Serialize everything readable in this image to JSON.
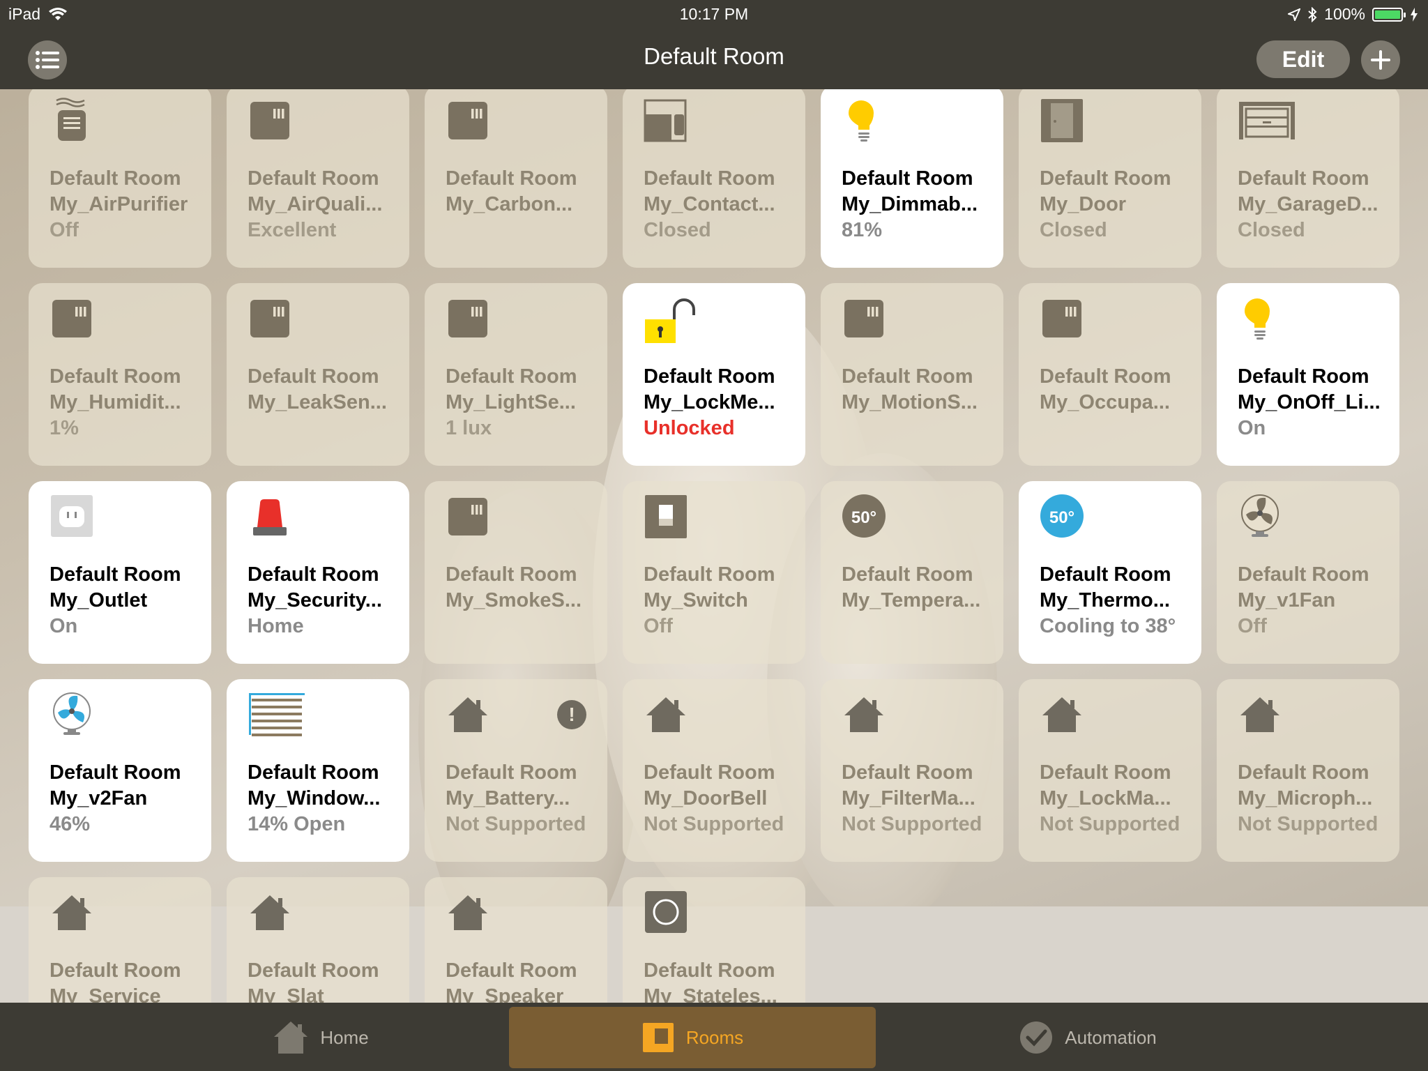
{
  "status_bar": {
    "device": "iPad",
    "time": "10:17 PM",
    "battery": "100%"
  },
  "nav": {
    "title": "Default Room",
    "edit_label": "Edit"
  },
  "tiles": [
    {
      "room": "Default Room",
      "name": "My_AirPurifier",
      "status": "Off",
      "state": "off",
      "icon": "air-purifier-icon"
    },
    {
      "room": "Default Room",
      "name": "My_AirQuali...",
      "status": "Excellent",
      "state": "off",
      "icon": "sensor-icon"
    },
    {
      "room": "Default Room",
      "name": "My_Carbon...",
      "status": "",
      "state": "off",
      "icon": "sensor-icon"
    },
    {
      "room": "Default Room",
      "name": "My_Contact...",
      "status": "Closed",
      "state": "off",
      "icon": "contact-sensor-icon"
    },
    {
      "room": "Default Room",
      "name": "My_Dimmab...",
      "status": "81%",
      "state": "on",
      "icon": "lightbulb-icon"
    },
    {
      "room": "Default Room",
      "name": "My_Door",
      "status": "Closed",
      "state": "off",
      "icon": "door-icon"
    },
    {
      "room": "Default Room",
      "name": "My_GarageD...",
      "status": "Closed",
      "state": "off",
      "icon": "garage-door-icon"
    },
    {
      "room": "Default Room",
      "name": "My_Humidit...",
      "status": "1%",
      "state": "off",
      "icon": "sensor-icon"
    },
    {
      "room": "Default Room",
      "name": "My_LeakSen...",
      "status": "",
      "state": "off",
      "icon": "sensor-icon"
    },
    {
      "room": "Default Room",
      "name": "My_LightSe...",
      "status": "1 lux",
      "state": "off",
      "icon": "sensor-icon"
    },
    {
      "room": "Default Room",
      "name": "My_LockMe...",
      "status": "Unlocked",
      "state": "on",
      "icon": "unlocked-padlock-icon",
      "status_color": "red"
    },
    {
      "room": "Default Room",
      "name": "My_MotionS...",
      "status": "",
      "state": "off",
      "icon": "sensor-icon"
    },
    {
      "room": "Default Room",
      "name": "My_Occupa...",
      "status": "",
      "state": "off",
      "icon": "sensor-icon"
    },
    {
      "room": "Default Room",
      "name": "My_OnOff_Li...",
      "status": "On",
      "state": "on",
      "icon": "lightbulb-icon"
    },
    {
      "room": "Default Room",
      "name": "My_Outlet",
      "status": "On",
      "state": "on",
      "icon": "outlet-icon"
    },
    {
      "room": "Default Room",
      "name": "My_Security...",
      "status": "Home",
      "state": "on",
      "icon": "security-siren-icon"
    },
    {
      "room": "Default Room",
      "name": "My_SmokeS...",
      "status": "",
      "state": "off",
      "icon": "sensor-icon"
    },
    {
      "room": "Default Room",
      "name": "My_Switch",
      "status": "Off",
      "state": "off",
      "icon": "switch-icon"
    },
    {
      "room": "Default Room",
      "name": "My_Tempera...",
      "status": "",
      "state": "off",
      "icon": "temperature-icon",
      "icon_text": "50°"
    },
    {
      "room": "Default Room",
      "name": "My_Thermo...",
      "status": "Cooling to 38°",
      "state": "on",
      "icon": "thermostat-icon",
      "icon_text": "50°"
    },
    {
      "room": "Default Room",
      "name": "My_v1Fan",
      "status": "Off",
      "state": "off",
      "icon": "fan-icon"
    },
    {
      "room": "Default Room",
      "name": "My_v2Fan",
      "status": "46%",
      "state": "on",
      "icon": "fan-icon"
    },
    {
      "room": "Default Room",
      "name": "My_Window...",
      "status": "14% Open",
      "state": "on",
      "icon": "window-covering-icon"
    },
    {
      "room": "Default Room",
      "name": "My_Battery...",
      "status": "Not Supported",
      "state": "off",
      "icon": "house-icon",
      "alert": "!"
    },
    {
      "room": "Default Room",
      "name": "My_DoorBell",
      "status": "Not Supported",
      "state": "off",
      "icon": "house-icon"
    },
    {
      "room": "Default Room",
      "name": "My_FilterMa...",
      "status": "Not Supported",
      "state": "off",
      "icon": "house-icon"
    },
    {
      "room": "Default Room",
      "name": "My_LockMa...",
      "status": "Not Supported",
      "state": "off",
      "icon": "house-icon"
    },
    {
      "room": "Default Room",
      "name": "My_Microph...",
      "status": "Not Supported",
      "state": "off",
      "icon": "house-icon"
    },
    {
      "room": "Default Room",
      "name": "My_Service",
      "status": "",
      "state": "off",
      "icon": "house-icon"
    },
    {
      "room": "Default Room",
      "name": "My_Slat",
      "status": "",
      "state": "off",
      "icon": "house-icon"
    },
    {
      "room": "Default Room",
      "name": "My_Speaker",
      "status": "",
      "state": "off",
      "icon": "house-icon"
    },
    {
      "room": "Default Room",
      "name": "My_Stateles...",
      "status": "",
      "state": "off",
      "icon": "stateless-button-icon"
    }
  ],
  "tabs": [
    {
      "label": "Home",
      "icon": "home-icon",
      "active": false
    },
    {
      "label": "Rooms",
      "icon": "rooms-icon",
      "active": true
    },
    {
      "label": "Automation",
      "icon": "automation-icon",
      "active": false
    }
  ],
  "colors": {
    "accent": "#f5a623",
    "bar": "#3d3b34",
    "alert_red": "#e8302a",
    "thermo_blue": "#34aadc"
  }
}
